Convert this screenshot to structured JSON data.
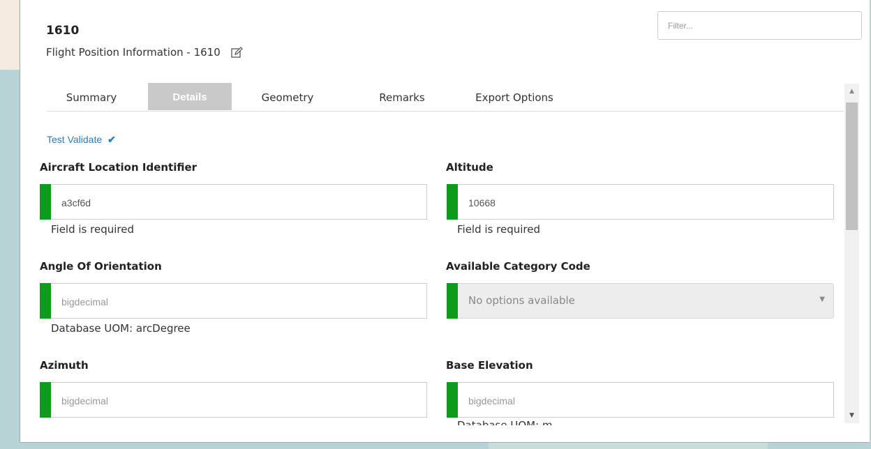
{
  "header": {
    "id": "1610",
    "subtitle": "Flight Position Information - 1610"
  },
  "filter": {
    "placeholder": "Filter..."
  },
  "tabs": [
    {
      "label": "Summary",
      "active": false
    },
    {
      "label": "Details",
      "active": true
    },
    {
      "label": "Geometry",
      "active": false
    },
    {
      "label": "Remarks",
      "active": false
    },
    {
      "label": "Export Options",
      "active": false
    }
  ],
  "validate": {
    "label": "Test Validate",
    "icon": "check-icon"
  },
  "fields": {
    "aircraft_location_identifier": {
      "label": "Aircraft Location Identifier",
      "value": "a3cf6d",
      "hint": "Field is required"
    },
    "altitude": {
      "label": "Altitude",
      "value": "10668",
      "hint": "Field is required"
    },
    "angle_of_orientation": {
      "label": "Angle Of Orientation",
      "placeholder": "bigdecimal",
      "hint": "Database UOM: arcDegree"
    },
    "available_category_code": {
      "label": "Available Category Code",
      "selected": "No options available"
    },
    "azimuth": {
      "label": "Azimuth",
      "placeholder": "bigdecimal"
    },
    "base_elevation": {
      "label": "Base Elevation",
      "placeholder": "bigdecimal",
      "hint": "Database UOM: m"
    }
  },
  "colors": {
    "required_bar": "#0e9a1a",
    "link": "#2a7bbd",
    "active_tab": "#c8c8c8"
  }
}
